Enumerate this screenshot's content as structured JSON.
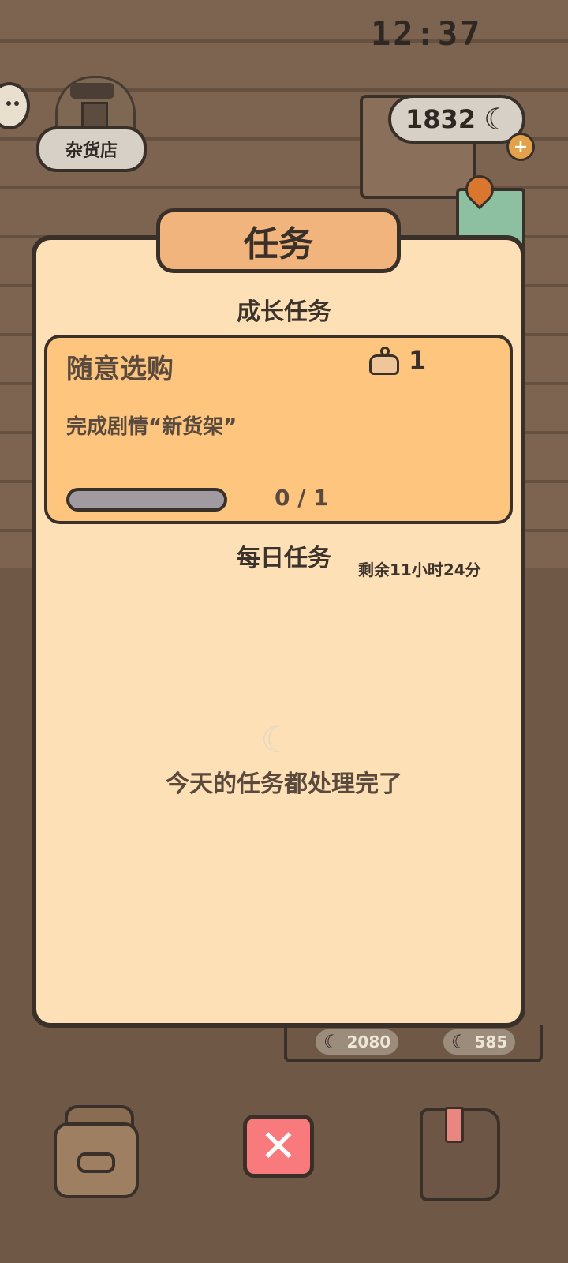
{
  "status": {
    "time": "12:37"
  },
  "hud": {
    "shop_label": "杂货店",
    "currency_amount": "1832",
    "currency_icon": "moon-icon",
    "plus_label": "+"
  },
  "modal": {
    "title": "任务",
    "growth_section_title": "成长任务",
    "task": {
      "name": "随意选购",
      "reward_count": "1",
      "description": "完成剧情“新货架”",
      "progress_text": "0 / 1",
      "progress_fraction": 0
    },
    "daily_section_title": "每日任务",
    "daily_remaining": "剩余11小时24分",
    "empty_message": "今天的任务都处理完了"
  },
  "background_prices": [
    "2080",
    "585"
  ],
  "bottom_bar": {
    "close_symbol": "✕"
  },
  "colors": {
    "modal_bg": "#fee0b6",
    "card_bg": "#fec57f",
    "close_button": "#f87a7d",
    "title_plank": "#f0b47c"
  }
}
